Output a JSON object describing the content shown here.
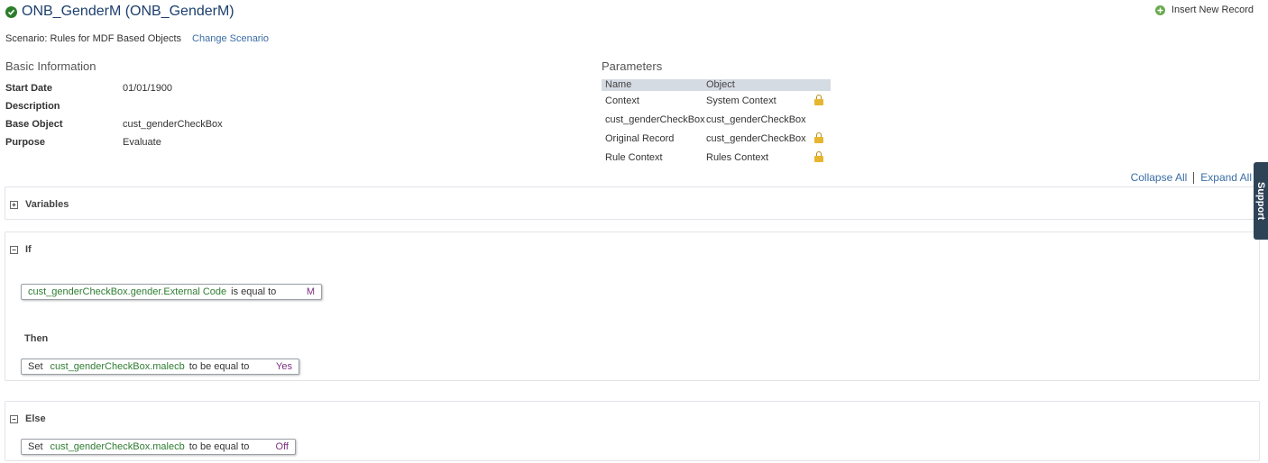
{
  "header": {
    "title": "ONB_GenderM (ONB_GenderM)",
    "insert_label": "Insert New Record"
  },
  "scenario": {
    "text": "Scenario: Rules for MDF Based Objects",
    "change_link": "Change Scenario"
  },
  "basic_info": {
    "heading": "Basic Information",
    "rows": [
      {
        "label": "Start Date",
        "value": "01/01/1900"
      },
      {
        "label": "Description",
        "value": ""
      },
      {
        "label": "Base Object",
        "value": "cust_genderCheckBox"
      },
      {
        "label": "Purpose",
        "value": "Evaluate"
      }
    ]
  },
  "parameters": {
    "heading": "Parameters",
    "columns": [
      "Name",
      "Object"
    ],
    "rows": [
      {
        "name": "Context",
        "object": "System Context",
        "locked": true
      },
      {
        "name": "cust_genderCheckBox",
        "object": "cust_genderCheckBox",
        "locked": false
      },
      {
        "name": "Original Record",
        "object": "cust_genderCheckBox",
        "locked": true
      },
      {
        "name": "Rule Context",
        "object": "Rules Context",
        "locked": true
      }
    ]
  },
  "controls": {
    "collapse_all": "Collapse All",
    "expand_all": "Expand All"
  },
  "variables": {
    "title": "Variables",
    "toggle": "+"
  },
  "if_block": {
    "title": "If",
    "toggle": "−",
    "condition": {
      "field": "cust_genderCheckBox.gender.External Code",
      "operator": "is equal to",
      "value": "M"
    },
    "then_label": "Then",
    "then_action": {
      "verb": "Set",
      "field": "cust_genderCheckBox.malecb",
      "operator": "to be equal to",
      "value": "Yes"
    }
  },
  "else_block": {
    "title": "Else",
    "toggle": "−",
    "action": {
      "verb": "Set",
      "field": "cust_genderCheckBox.malecb",
      "operator": "to be equal to",
      "value": "Off"
    }
  },
  "support_tab": "Support",
  "colors": {
    "title": "#1c3f6e",
    "link": "#3a6ea5",
    "field": "#2e7d32",
    "value": "#7b2d80",
    "check": "#2b7d2b"
  },
  "icons": [
    "check-circle-icon",
    "plus-circle-icon",
    "lock-icon",
    "expand-icon",
    "collapse-icon"
  ]
}
